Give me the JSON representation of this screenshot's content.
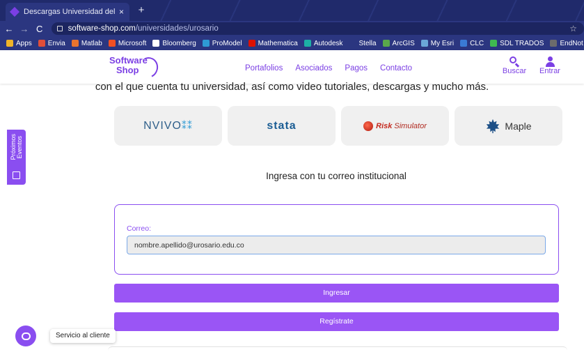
{
  "browser": {
    "tab_title": "Descargas Universidad del Rosari",
    "tab_close": "×",
    "new_tab": "+",
    "back": "←",
    "forward": "→",
    "reload": "C",
    "url_host": "software-shop.com",
    "url_path": "/universidades/urosario",
    "star": "☆"
  },
  "bookmarks": [
    {
      "label": "Apps",
      "color": "#f0b429"
    },
    {
      "label": "Envia",
      "color": "#e04e39"
    },
    {
      "label": "Matlab",
      "color": "#e9742e"
    },
    {
      "label": "Microsoft",
      "color": "#f25022"
    },
    {
      "label": "Bloomberg",
      "color": "#ffffff"
    },
    {
      "label": "ProModel",
      "color": "#2e9ad4"
    },
    {
      "label": "Mathematica",
      "color": "#dd1100"
    },
    {
      "label": "Autodesk",
      "color": "#1db0a5"
    },
    {
      "label": "Stella",
      "color": "#2b3680"
    },
    {
      "label": "ArcGIS",
      "color": "#5aa84b"
    },
    {
      "label": "My Esri",
      "color": "#6aa7d8"
    },
    {
      "label": "CLC",
      "color": "#3a7bd5"
    },
    {
      "label": "SDL TRADOS",
      "color": "#3fb950"
    },
    {
      "label": "EndNot",
      "color": "#6c6c6c"
    }
  ],
  "header": {
    "logo_line1": "Software",
    "logo_line2": "Shop",
    "nav": [
      "Portafolios",
      "Asociados",
      "Pagos",
      "Contacto"
    ],
    "search_label": "Buscar",
    "login_label": "Entrar"
  },
  "intro_text": "con el que cuenta tu universidad, así como video tutoriales, descargas y mucho más.",
  "products": {
    "nvivo": "NVIVO",
    "nvivo_mark": "⁑⁑",
    "stata": "stata",
    "risk": "Risk",
    "risk_sim": "Simulator",
    "maple": "Maple"
  },
  "side_tab": {
    "line1": "Próximos",
    "line2": "Eventos"
  },
  "login": {
    "heading": "Ingresa con tu correo institucional",
    "label": "Correo:",
    "value": "nombre.apellido@urosario.edu.co",
    "submit": "Ingresar",
    "register": "Regístrate"
  },
  "chat": {
    "label": "Servicio al cliente"
  },
  "colors": {
    "brand_purple": "#8a4ef0",
    "browser_dark": "#202a6b"
  }
}
